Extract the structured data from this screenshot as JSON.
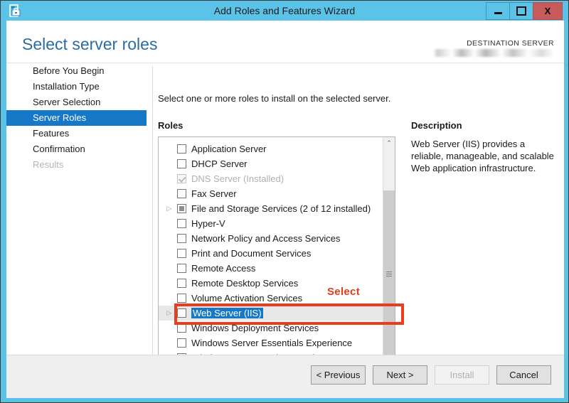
{
  "window": {
    "title": "Add Roles and Features Wizard",
    "icon": "server-wizard-icon",
    "minimize_label": "–",
    "maximize_label": "☐",
    "close_label": "X"
  },
  "header": {
    "page_title": "Select server roles",
    "destination_label": "DESTINATION SERVER",
    "destination_value": ""
  },
  "nav": {
    "items": [
      {
        "label": "Before You Begin",
        "state": "normal"
      },
      {
        "label": "Installation Type",
        "state": "normal"
      },
      {
        "label": "Server Selection",
        "state": "normal"
      },
      {
        "label": "Server Roles",
        "state": "active"
      },
      {
        "label": "Features",
        "state": "normal"
      },
      {
        "label": "Confirmation",
        "state": "normal"
      },
      {
        "label": "Results",
        "state": "disabled"
      }
    ]
  },
  "content": {
    "instruction": "Select one or more roles to install on the selected server.",
    "roles_label": "Roles",
    "description_label": "Description",
    "description_text": "Web Server (IIS) provides a reliable, manageable, and scalable Web application infrastructure."
  },
  "roles": [
    {
      "label": "Application Server",
      "checkbox": "unchecked",
      "expandable": false,
      "dim": false,
      "selected": false
    },
    {
      "label": "DHCP Server",
      "checkbox": "unchecked",
      "expandable": false,
      "dim": false,
      "selected": false
    },
    {
      "label": "DNS Server (Installed)",
      "checkbox": "installed",
      "expandable": false,
      "dim": true,
      "selected": false
    },
    {
      "label": "Fax Server",
      "checkbox": "unchecked",
      "expandable": false,
      "dim": false,
      "selected": false
    },
    {
      "label": "File and Storage Services (2 of 12 installed)",
      "checkbox": "partial",
      "expandable": true,
      "dim": false,
      "selected": false
    },
    {
      "label": "Hyper-V",
      "checkbox": "unchecked",
      "expandable": false,
      "dim": false,
      "selected": false
    },
    {
      "label": "Network Policy and Access Services",
      "checkbox": "unchecked",
      "expandable": false,
      "dim": false,
      "selected": false
    },
    {
      "label": "Print and Document Services",
      "checkbox": "unchecked",
      "expandable": false,
      "dim": false,
      "selected": false
    },
    {
      "label": "Remote Access",
      "checkbox": "unchecked",
      "expandable": false,
      "dim": false,
      "selected": false
    },
    {
      "label": "Remote Desktop Services",
      "checkbox": "unchecked",
      "expandable": false,
      "dim": false,
      "selected": false
    },
    {
      "label": "Volume Activation Services",
      "checkbox": "unchecked",
      "expandable": false,
      "dim": false,
      "selected": false
    },
    {
      "label": "Web Server (IIS)",
      "checkbox": "unchecked",
      "expandable": true,
      "dim": false,
      "selected": true
    },
    {
      "label": "Windows Deployment Services",
      "checkbox": "unchecked",
      "expandable": false,
      "dim": false,
      "selected": false
    },
    {
      "label": "Windows Server Essentials Experience",
      "checkbox": "unchecked",
      "expandable": false,
      "dim": false,
      "selected": false
    },
    {
      "label": "Windows Server Update Services",
      "checkbox": "unchecked",
      "expandable": false,
      "dim": false,
      "selected": false
    }
  ],
  "scrollbar": {
    "up_arrow": "⌃",
    "down_arrow": "⌄"
  },
  "annotation": {
    "text": "Select",
    "color": "#e13c1d"
  },
  "footer": {
    "buttons": [
      {
        "label": "< Previous",
        "disabled": false
      },
      {
        "label": "Next >",
        "disabled": false
      },
      {
        "label": "Install",
        "disabled": true
      },
      {
        "label": "Cancel",
        "disabled": false
      }
    ]
  },
  "colors": {
    "frame": "#5bc3e8",
    "accent": "#1878c8",
    "title_link": "#2c6ca0",
    "annotation": "#ed3b1e"
  }
}
